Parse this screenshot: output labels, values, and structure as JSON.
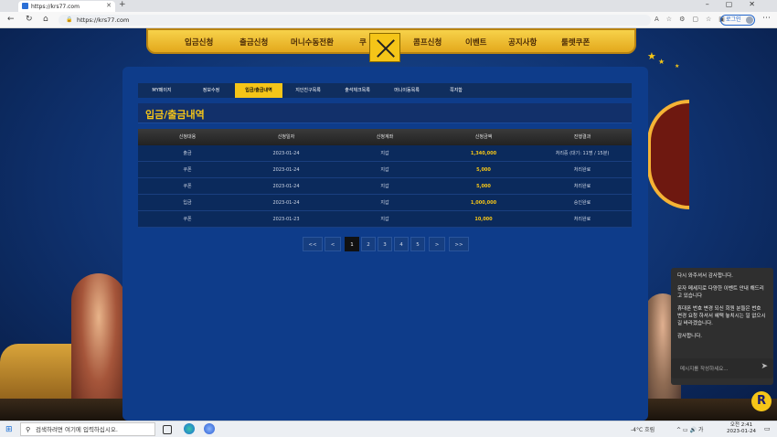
{
  "browser": {
    "tab_title": "https://krs77.com",
    "url": "https://krs77.com",
    "login_label": "로그인"
  },
  "site": {
    "nav": [
      "입금신청",
      "출금신청",
      "머니수동전환",
      "쿠",
      "콤프신청",
      "이벤트",
      "공지사항",
      "룰렛쿠폰"
    ]
  },
  "subtabs": [
    {
      "label": "MY페이지",
      "active": false
    },
    {
      "label": "정보수정",
      "active": false
    },
    {
      "label": "입금/출금내역",
      "active": true
    },
    {
      "label": "지인친구목록",
      "active": false
    },
    {
      "label": "출석체크목록",
      "active": false
    },
    {
      "label": "머니이동목록",
      "active": false
    },
    {
      "label": "쪽지함",
      "active": false
    }
  ],
  "section_title": "입금/출금내역",
  "table": {
    "headers": [
      "신청대용",
      "신청일자",
      "신청계좌",
      "신청금액",
      "진행결과"
    ],
    "rows": [
      [
        "출금",
        "2023-01-24",
        "지갑",
        "1,340,000",
        "처리중 (대기: 11명 / 15분)"
      ],
      [
        "쿠폰",
        "2023-01-24",
        "지갑",
        "5,000",
        "처리완료"
      ],
      [
        "쿠폰",
        "2023-01-24",
        "지갑",
        "5,000",
        "처리완료"
      ],
      [
        "입금",
        "2023-01-24",
        "지갑",
        "1,000,000",
        "승인완료"
      ],
      [
        "쿠폰",
        "2023-01-23",
        "지갑",
        "10,000",
        "처리완료"
      ]
    ]
  },
  "pagination": {
    "items": [
      "<<",
      "<",
      "1",
      "2",
      "3",
      "4",
      "5",
      ">",
      ">>"
    ],
    "current": "1"
  },
  "chat": {
    "messages": [
      "다시 와주셔서 감사합니다.",
      "문자 메세지로 다양한 이벤트 안내 해드리고 있습니다",
      "휴대폰 번호 변경 되신 회원 분들은 번호 변경 요청 하셔서 혜택 놓치시는 일 없으시길 바라겠습니다.",
      "감사합니다."
    ],
    "input_placeholder": "메시지를 작성하세요..."
  },
  "taskbar": {
    "search_placeholder": "검색하려면 여기에 입력하십시오.",
    "weather": "-4°C 흐림",
    "time": "오전 2:41",
    "date": "2023-01-24"
  }
}
